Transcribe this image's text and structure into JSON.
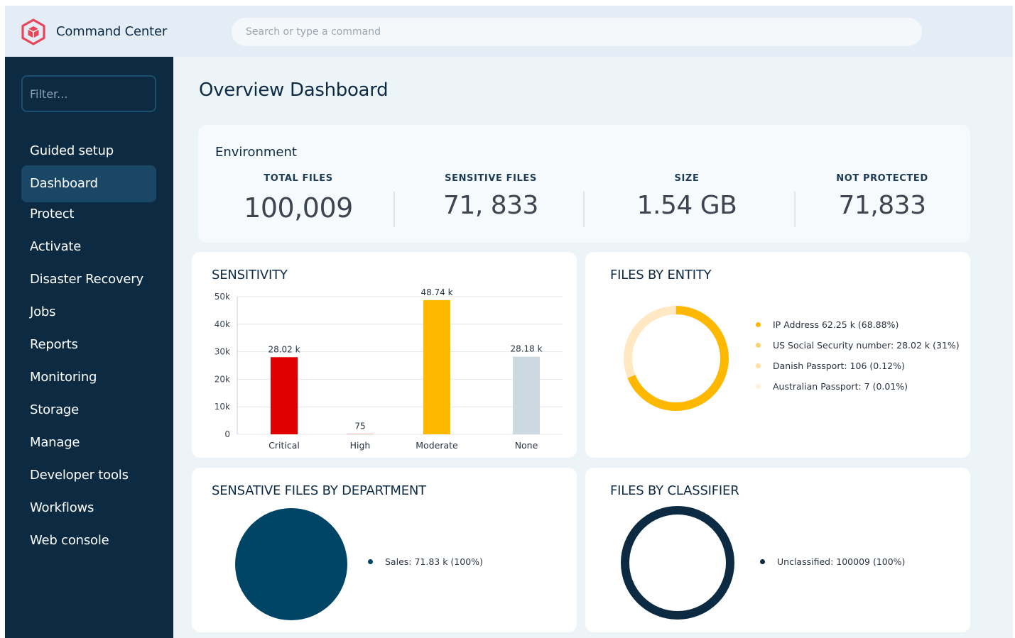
{
  "app": {
    "title": "Command Center"
  },
  "search": {
    "placeholder": "Search or type a command"
  },
  "sidebar": {
    "filter_placeholder": "Filter...",
    "items": [
      {
        "label": "Guided setup"
      },
      {
        "label": "Dashboard",
        "active": true
      },
      {
        "label": "Protect"
      },
      {
        "label": "Activate"
      },
      {
        "label": "Disaster Recovery"
      },
      {
        "label": "Jobs"
      },
      {
        "label": "Reports"
      },
      {
        "label": "Monitoring"
      },
      {
        "label": "Storage"
      },
      {
        "label": "Manage"
      },
      {
        "label": "Developer tools"
      },
      {
        "label": "Workflows"
      },
      {
        "label": "Web console"
      }
    ]
  },
  "page": {
    "title": "Overview Dashboard"
  },
  "environment": {
    "title": "Environment",
    "stats": [
      {
        "label": "TOTAL FILES",
        "value": "100,009"
      },
      {
        "label": "SENSITIVE FILES",
        "value": "71, 833"
      },
      {
        "label": "SIZE",
        "value": "1.54 GB"
      },
      {
        "label": "NOT PROTECTED",
        "value": "71,833"
      }
    ]
  },
  "colors": {
    "sidebar_bg": "#0c2b43",
    "accent": "#1a4766",
    "critical": "#e00000",
    "moderate": "#ffb800",
    "none": "#cdd9e0",
    "dept": "#004466",
    "classifier": "#0c2b43",
    "logo": "#e8455a"
  },
  "charts": {
    "sensitivity": {
      "title": "SENSITIVITY"
    },
    "entity": {
      "title": "FILES BY ENTITY"
    },
    "department": {
      "title": "SENSATIVE FILES BY DEPARTMENT"
    },
    "classifier": {
      "title": "FILES BY CLASSIFIER"
    }
  },
  "chart_data": [
    {
      "type": "bar",
      "title": "SENSITIVITY",
      "categories": [
        "Critical",
        "High",
        "Moderate",
        "None"
      ],
      "values": [
        28020,
        75,
        48740,
        28180
      ],
      "data_labels": [
        "28.02 k",
        "75",
        "48.74 k",
        "28.18 k"
      ],
      "colors": [
        "#e00000",
        "#e00000",
        "#ffb800",
        "#cdd9e0"
      ],
      "ylim": [
        0,
        50000
      ],
      "yticks": [
        0,
        10000,
        20000,
        30000,
        40000,
        50000
      ],
      "ytick_labels": [
        "0",
        "10k",
        "20k",
        "30k",
        "40k",
        "50k"
      ],
      "grid": true
    },
    {
      "type": "pie",
      "donut": true,
      "title": "FILES BY ENTITY",
      "slices": [
        {
          "label": "IP Address 62.25 k (68.88%)",
          "value": 62250,
          "percent": 68.88,
          "color": "#ffb800"
        },
        {
          "label": "US Social Security number: 28.02 k (31%)",
          "value": 28020,
          "percent": 31.0,
          "color": "#ffe8c2"
        },
        {
          "label": "Danish Passport: 106 (0.12%)",
          "value": 106,
          "percent": 0.12,
          "color": "#ffd98a"
        },
        {
          "label": "Australian Passport: 7 (0.01%)",
          "value": 7,
          "percent": 0.01,
          "color": "#fff2da"
        }
      ],
      "legend_dot_colors": [
        "#ffb800",
        "#ffd070",
        "#ffe0a0",
        "#fff0d8"
      ],
      "legend": "right"
    },
    {
      "type": "pie",
      "title": "SENSATIVE FILES BY DEPARTMENT",
      "slices": [
        {
          "label": "Sales: 71.83 k (100%)",
          "value": 71830,
          "percent": 100,
          "color": "#004466"
        }
      ],
      "legend": "right"
    },
    {
      "type": "pie",
      "donut": true,
      "title": "FILES BY CLASSIFIER",
      "slices": [
        {
          "label": "Unclassified: 100009 (100%)",
          "value": 100009,
          "percent": 100,
          "color": "#0c2b43"
        }
      ],
      "legend": "right"
    }
  ]
}
